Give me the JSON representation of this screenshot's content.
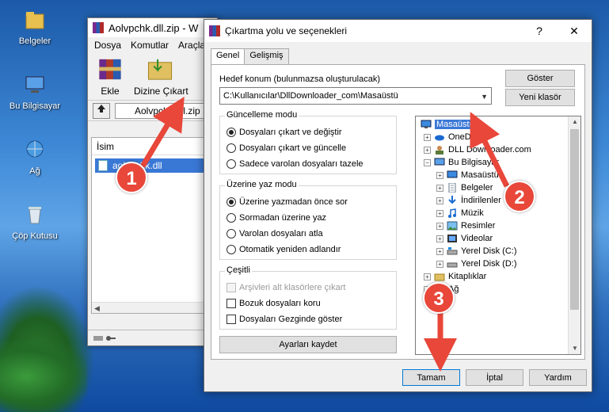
{
  "desktop": {
    "icons": [
      {
        "label": "Belgeler"
      },
      {
        "label": "Bu Bilgisayar"
      },
      {
        "label": "Ağ"
      },
      {
        "label": "Çöp Kutusu"
      }
    ]
  },
  "winrar": {
    "title": "Aolvpchk.dll.zip - W",
    "menu": [
      "Dosya",
      "Komutlar",
      "Araçla"
    ],
    "tools": [
      {
        "label": "Ekle",
        "icon": "add-archive-icon"
      },
      {
        "label": "Dizine Çıkart",
        "icon": "extract-to-icon"
      }
    ],
    "address": "Aolvpchk.dll.zip",
    "list_header": "İsim",
    "files": [
      "aolvpchk.dll"
    ]
  },
  "dialog": {
    "title": "Çıkartma yolu ve seçenekleri",
    "help": "?",
    "close": "✕",
    "tabs": [
      "Genel",
      "Gelişmiş"
    ],
    "dest_label": "Hedef konum (bulunmazsa oluşturulacak)",
    "dest_path": "C:\\Kullanıcılar\\DllDownloader_com\\Masaüstü",
    "show_button": "Göster",
    "new_folder_button": "Yeni klasör",
    "update_group": {
      "title": "Güncelleme modu",
      "options": [
        "Dosyaları çıkart ve değiştir",
        "Dosyaları çıkart ve güncelle",
        "Sadece varolan dosyaları tazele"
      ],
      "selected": 0
    },
    "overwrite_group": {
      "title": "Üzerine yaz modu",
      "options": [
        "Üzerine yazmadan önce sor",
        "Sormadan üzerine yaz",
        "Varolan dosyaları atla",
        "Otomatik yeniden adlandır"
      ],
      "selected": 0
    },
    "misc_group": {
      "title": "Çeşitli",
      "options": [
        "Arşivleri alt klasörlere çıkart",
        "Bozuk dosyaları koru",
        "Dosyaları Gezginde göster"
      ]
    },
    "save_button": "Ayarları kaydet",
    "tree": [
      {
        "label": "Masaüstü",
        "selected": true,
        "icon": "desktop-icon"
      },
      {
        "label": "OneDrive",
        "icon": "onedrive-icon"
      },
      {
        "label": "DLL Downloader.com",
        "icon": "user-icon"
      },
      {
        "label": "Bu Bilgisayar",
        "icon": "computer-icon"
      },
      {
        "label": "Masaüstü",
        "icon": "desktop-icon"
      },
      {
        "label": "Belgeler",
        "icon": "documents-icon"
      },
      {
        "label": "İndirilenler",
        "icon": "downloads-icon"
      },
      {
        "label": "Müzik",
        "icon": "music-icon"
      },
      {
        "label": "Resimler",
        "icon": "pictures-icon"
      },
      {
        "label": "Videolar",
        "icon": "videos-icon"
      },
      {
        "label": "Yerel Disk (C:)",
        "icon": "drive-icon"
      },
      {
        "label": "Yerel Disk (D:)",
        "icon": "drive-icon"
      },
      {
        "label": "Kitaplıklar",
        "icon": "libraries-icon"
      },
      {
        "label": "Ağ",
        "icon": "network-icon"
      }
    ],
    "ok_button": "Tamam",
    "cancel_button": "İptal",
    "help_button": "Yardım"
  },
  "annotations": {
    "step1": "1",
    "step2": "2",
    "step3": "3",
    "color": "#e8473a"
  }
}
